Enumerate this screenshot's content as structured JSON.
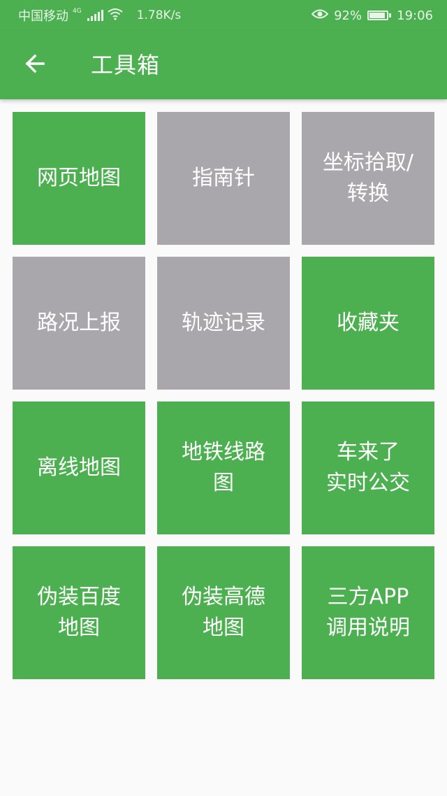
{
  "status_bar": {
    "carrier": "中国移动",
    "network": "4G",
    "speed": "1.78K/s",
    "battery": "92%",
    "battery_level": 0.92,
    "time": "19:06",
    "icons": [
      "signal-icon",
      "wifi-icon",
      "eye-icon",
      "battery-icon"
    ]
  },
  "app_bar": {
    "title": "工具箱",
    "back_icon": "arrow-left-icon"
  },
  "colors": {
    "primary": "#4caf50",
    "disabled": "#a9a7ab",
    "background": "#fafafa"
  },
  "tiles": [
    {
      "label": "网页地图",
      "state": "active"
    },
    {
      "label": "指南针",
      "state": "disabled"
    },
    {
      "label": "坐标拾取/\n转换",
      "state": "disabled"
    },
    {
      "label": "路况上报",
      "state": "disabled"
    },
    {
      "label": "轨迹记录",
      "state": "disabled"
    },
    {
      "label": "收藏夹",
      "state": "active"
    },
    {
      "label": "离线地图",
      "state": "active"
    },
    {
      "label": "地铁线路\n图",
      "state": "active"
    },
    {
      "label": "车来了\n实时公交",
      "state": "active"
    },
    {
      "label": "伪装百度\n地图",
      "state": "active"
    },
    {
      "label": "伪装高德\n地图",
      "state": "active"
    },
    {
      "label": "三方APP\n调用说明",
      "state": "active"
    }
  ]
}
